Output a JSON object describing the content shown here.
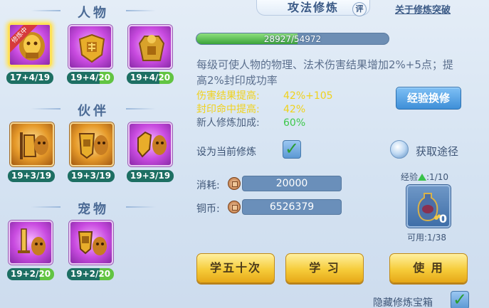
{
  "left": {
    "sections": [
      {
        "title": "人物",
        "slots": [
          {
            "label": "17+4/19",
            "selected": true,
            "ribbon": "修炼中",
            "icon": "gold-lion-helmet-icon",
            "color": "purple",
            "partial": false
          },
          {
            "label": "19+4/20",
            "selected": false,
            "icon": "gold-shield-icon",
            "color": "purple",
            "partial": true
          },
          {
            "label": "19+4/20",
            "selected": false,
            "icon": "gold-armor-icon",
            "color": "purple",
            "partial": true
          }
        ]
      },
      {
        "title": "伙伴",
        "slots": [
          {
            "label": "19+3/19",
            "icon": "warrior-lion-icon",
            "color": "orange",
            "partial": false
          },
          {
            "label": "19+3/19",
            "icon": "shield-lion-icon",
            "color": "orange",
            "partial": false
          },
          {
            "label": "19+3/19",
            "icon": "gauntlet-lion-icon",
            "color": "purple",
            "partial": false
          }
        ]
      },
      {
        "title": "宠物",
        "slots": [
          {
            "label": "19+2/20",
            "icon": "sword-lion-icon",
            "color": "purple",
            "partial": true
          },
          {
            "label": "19+2/20",
            "icon": "shield-lion-pet-icon",
            "color": "purple",
            "partial": true
          }
        ]
      }
    ]
  },
  "header": {
    "title": "攻法修炼",
    "rate_label": "评",
    "about_link": "关于修炼突破"
  },
  "exp": {
    "current": 28927,
    "max": 54972,
    "text": "28927/54972"
  },
  "description": "每级可使人物的物理、法术伤害结果增加2%+5点；提高2%封印成功率",
  "stats": [
    {
      "key": "伤害结果提高:",
      "value": "42%+105",
      "color": "yellow"
    },
    {
      "key": "封印命中提高:",
      "value": "42%",
      "color": "yellow"
    },
    {
      "key": "新人修炼加成:",
      "value": "60%",
      "color": "green"
    }
  ],
  "exchange_button": "经验换修",
  "set_current_label": "设为当前修炼",
  "set_current_checked": true,
  "get_path_label": "获取途径",
  "cost": {
    "label": "消耗:",
    "value": "20000"
  },
  "coins": {
    "label": "铜币:",
    "value": "6526379"
  },
  "item": {
    "exp_label": "经验",
    "exp_value": ":1/10",
    "count": "0",
    "usable": "可用:1/38"
  },
  "buttons": {
    "learn50": "学五十次",
    "learn": "学 习",
    "use": "使 用"
  },
  "hide_box": {
    "label": "隐藏修炼宝箱",
    "checked": true
  },
  "colors": {
    "yellow": "#f0d21c",
    "green": "#3ec84b",
    "button_blue": "#3e8fd8",
    "button_yellow": "#f6cc3a"
  }
}
